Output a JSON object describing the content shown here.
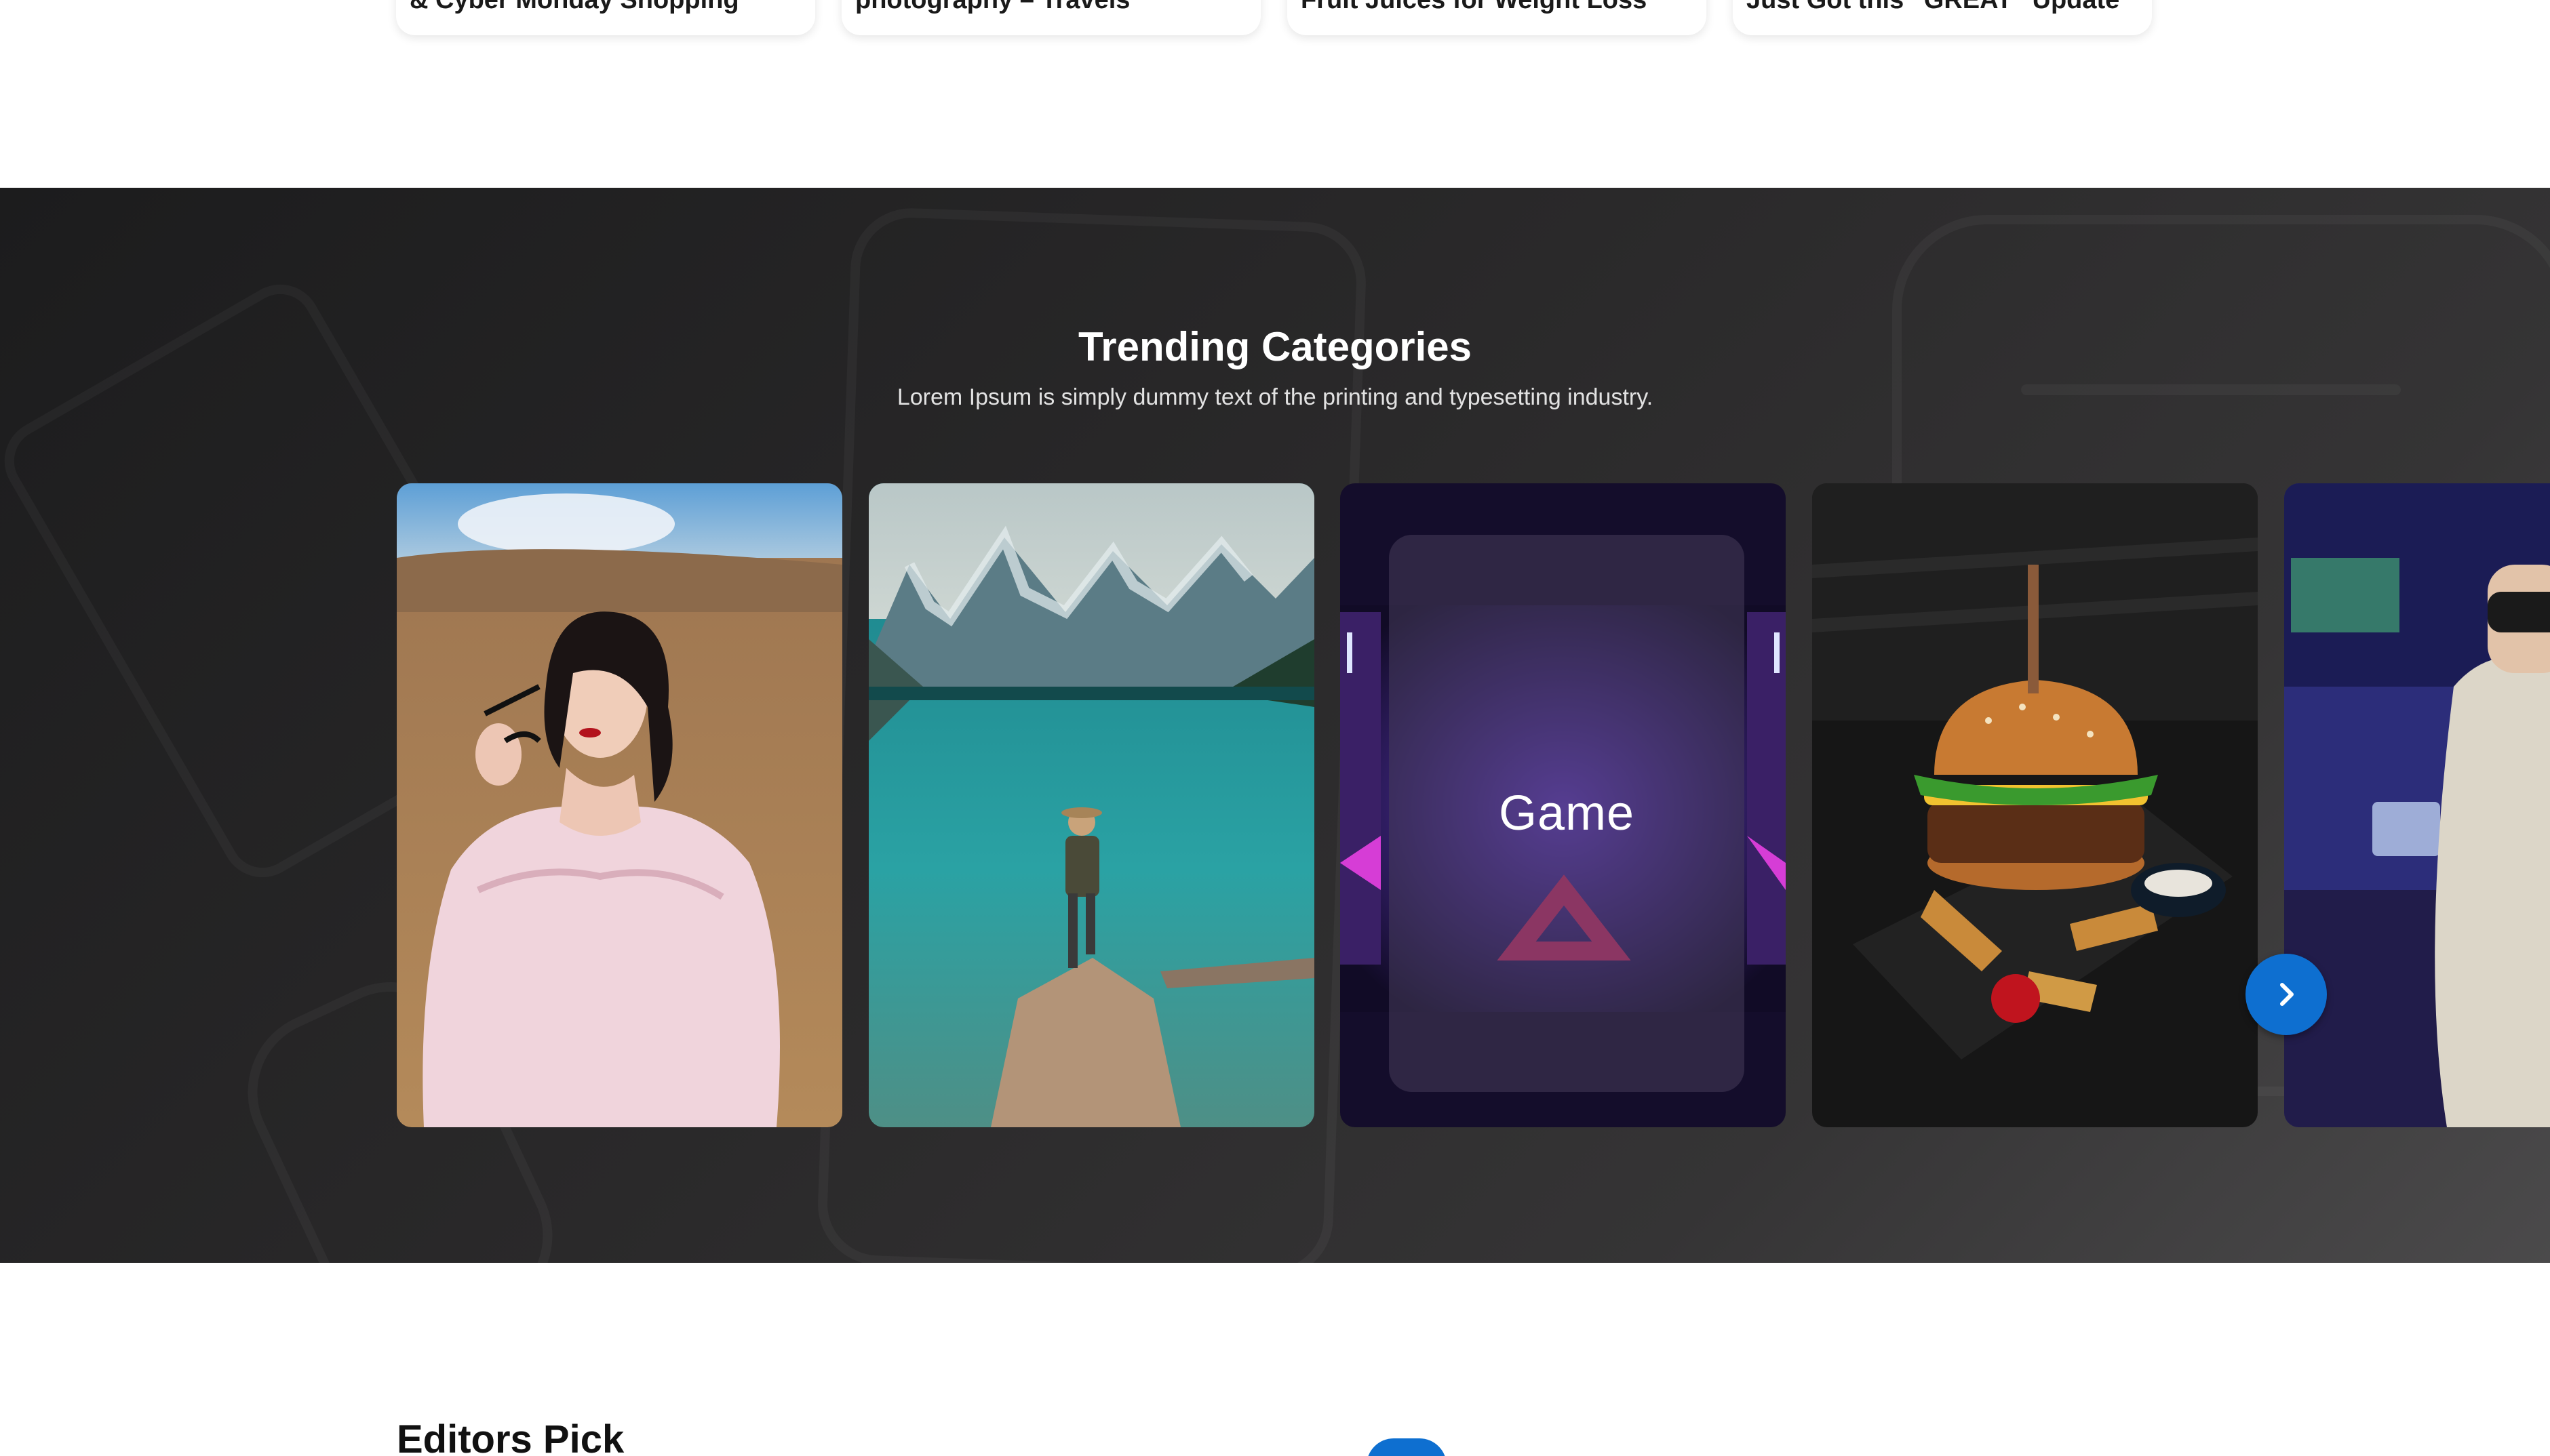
{
  "top_cards": [
    {
      "title": "& Cyber Monday Shopping"
    },
    {
      "title": "photography – Travels"
    },
    {
      "title": "Fruit Juices for Weight Loss"
    },
    {
      "title": "Just Got this “GREAT” Update"
    }
  ],
  "trending": {
    "title": "Trending Categories",
    "subtitle": "Lorem Ipsum is simply dummy text of the printing and typesetting industry.",
    "hover_label": "Game",
    "next_icon": "chevron-right-icon"
  },
  "editors_pick": {
    "title": "Editors Pick"
  },
  "colors": {
    "accent": "#0e6fd0",
    "section_bg": "#2a292a",
    "text_light": "#ffffff"
  }
}
